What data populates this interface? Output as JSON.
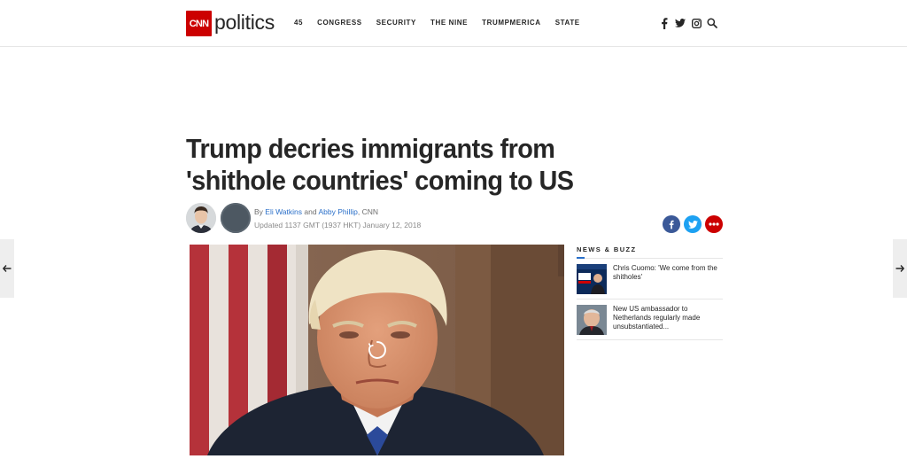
{
  "header": {
    "logo_text": "CNN",
    "section": "politics",
    "nav": [
      "45",
      "CONGRESS",
      "SECURITY",
      "THE NINE",
      "TRUMPMERICA",
      "STATE"
    ],
    "icons": [
      "facebook-icon",
      "twitter-icon",
      "instagram-icon",
      "search-icon"
    ]
  },
  "article": {
    "headline": "Trump decries immigrants from 'shithole countries' coming to US",
    "byline_prefix": "By",
    "author_1": "Eli Watkins",
    "byline_and": "and",
    "author_2": "Abby Phillip",
    "byline_suffix": ", CNN",
    "updated": "Updated 1137 GMT (1937 HKT) January 12, 2018"
  },
  "share": [
    "facebook-share",
    "twitter-share",
    "more-share"
  ],
  "news_buzz": {
    "title": "NEWS & BUZZ",
    "items": [
      {
        "text": "Chris Cuomo: 'We come from the shitholes'"
      },
      {
        "text": "New US ambassador to Netherlands regularly made unsubstantiated..."
      }
    ]
  },
  "colors": {
    "brand_red": "#cc0000",
    "link_blue": "#2a6fc9",
    "facebook": "#3b5998",
    "twitter": "#1da1f2"
  }
}
